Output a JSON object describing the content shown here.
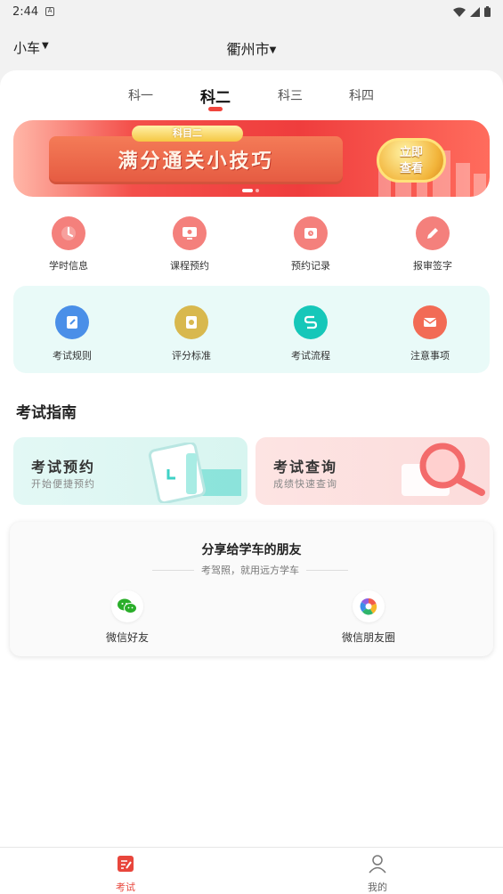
{
  "status_bar": {
    "time": "2:44",
    "notification_glyph": "A"
  },
  "header": {
    "car_type": "小车",
    "city": "衢州市"
  },
  "subject_tabs": [
    {
      "label": "科一"
    },
    {
      "label": "科二"
    },
    {
      "label": "科三"
    },
    {
      "label": "科四"
    }
  ],
  "active_subject": "科二",
  "banner": {
    "tag": "科目二",
    "title": "满分通关小技巧",
    "button_line1": "立即",
    "button_line2": "查看",
    "page_count": 2,
    "active_page": 1
  },
  "quick_actions": [
    {
      "label": "学时信息",
      "icon": "clock-icon"
    },
    {
      "label": "课程预约",
      "icon": "monitor-icon"
    },
    {
      "label": "预约记录",
      "icon": "record-icon"
    },
    {
      "label": "报审签字",
      "icon": "pen-icon"
    }
  ],
  "exam_tools": [
    {
      "label": "考试规则",
      "icon": "edit-icon",
      "color": "#4a8fe8"
    },
    {
      "label": "评分标准",
      "icon": "badge-icon",
      "color": "#d8b84e"
    },
    {
      "label": "考试流程",
      "icon": "flow-icon",
      "color": "#16c7b9"
    },
    {
      "label": "注意事项",
      "icon": "mail-icon",
      "color": "#f26b55"
    }
  ],
  "guide": {
    "section_title": "考试指南",
    "cards": [
      {
        "title": "考试预约",
        "subtitle": "开始便捷预约"
      },
      {
        "title": "考试查询",
        "subtitle": "成绩快速查询"
      }
    ]
  },
  "share": {
    "title": "分享给学车的朋友",
    "subtitle": "考驾照，就用远方学车",
    "targets": [
      {
        "label": "微信好友",
        "icon": "wechat-icon"
      },
      {
        "label": "微信朋友圈",
        "icon": "moments-icon"
      }
    ]
  },
  "bottom_nav": [
    {
      "label": "考试",
      "icon": "exam-icon",
      "active": true
    },
    {
      "label": "我的",
      "icon": "user-icon",
      "active": false
    }
  ],
  "colors": {
    "accent": "#e8463c",
    "exam_bg": "#e9faf8"
  }
}
